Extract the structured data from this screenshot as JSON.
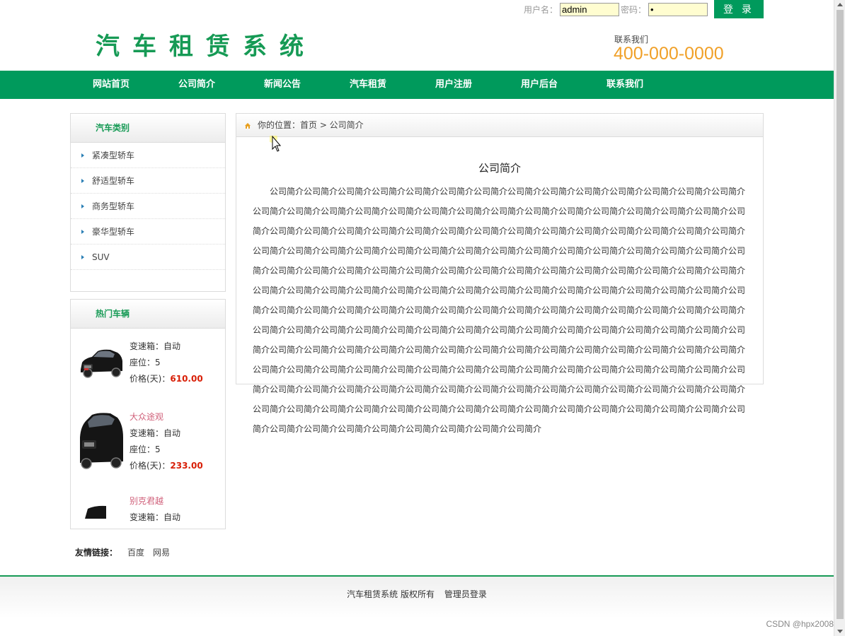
{
  "login": {
    "username_label": "用户名：",
    "username_value": "admin",
    "password_label": "密码：",
    "password_value": "•",
    "button_label": "登 录"
  },
  "header": {
    "logo": "汽车租赁系统",
    "contact_label": "联系我们",
    "contact_phone": "400-000-0000"
  },
  "nav": [
    "网站首页",
    "公司简介",
    "新闻公告",
    "汽车租赁",
    "用户注册",
    "用户后台",
    "联系我们"
  ],
  "sidebar": {
    "category_title": "汽车类别",
    "categories": [
      "紧凑型轿车",
      "舒适型轿车",
      "商务型轿车",
      "豪华型轿车",
      "SUV"
    ],
    "hot_title": "热门车辆",
    "hot_cars": [
      {
        "name": "",
        "gearbox": "变速箱：自动",
        "seats": "座位：5",
        "price_label": "价格(天)：",
        "price": "610.00"
      },
      {
        "name": "大众途观",
        "gearbox": "变速箱：自动",
        "seats": "座位：5",
        "price_label": "价格(天)：",
        "price": "233.00"
      },
      {
        "name": "别克君越",
        "gearbox": "变速箱：自动",
        "seats": "",
        "price_label": "",
        "price": ""
      }
    ]
  },
  "content": {
    "breadcrumb": "你的位置：首页 > 公司简介",
    "title": "公司简介",
    "body": "公司简介公司简介公司简介公司简介公司简介公司简介公司简介公司简介公司简介公司简介公司简介公司简介公司简介公司简介公司简介公司简介公司简介公司简介公司简介公司简介公司简介公司简介公司简介公司简介公司简介公司简介公司简介公司简介公司简介公司简介公司简介公司简介公司简介公司简介公司简介公司简介公司简介公司简介公司简介公司简介公司简介公司简介公司简介公司简介公司简介公司简介公司简介公司简介公司简介公司简介公司简介公司简介公司简介公司简介公司简介公司简介公司简介公司简介公司简介公司简介公司简介公司简介公司简介公司简介公司简介公司简介公司简介公司简介公司简介公司简介公司简介公司简介公司简介公司简介公司简介公司简介公司简介公司简介公司简介公司简介公司简介公司简介公司简介公司简介公司简介公司简介公司简介公司简介公司简介公司简介公司简介公司简介公司简介公司简介公司简介公司简介公司简介公司简介公司简介公司简介公司简介公司简介公司简介公司简介公司简介公司简介公司简介公司简介公司简介公司简介公司简介公司简介公司简介公司简介公司简介公司简介公司简介公司简介公司简介公司简介公司简介公司简介公司简介公司简介公司简介公司简介公司简介公司简介公司简介公司简介公司简介公司简介公司简介公司简介公司简介公司简介公司简介公司简介公司简介公司简介公司简介公司简介公司简介公司简介公司简介公司简介公司简介公司简介公司简介公司简介公司简介公司简介公司简介公司简介公司简介公司简介公司简介公司简介公司简介公司简介公司简介公司简介公司简介公司简介公司简介公司简介公司简介公司简介公司简介公司简介公司简介公司简介公司简介公司简介公司简介公司简介公司简介公司简介公司简介公司简介公司简介公司简介"
  },
  "links": {
    "label": "友情链接：",
    "items": [
      "百度",
      "网易"
    ]
  },
  "footer": {
    "copyright": "汽车租赁系统 版权所有",
    "admin_login": "管理员登录"
  },
  "watermark": "CSDN @hpx2008",
  "colors": {
    "brand_green": "#009a5c",
    "phone_orange": "#f0a028",
    "price_red": "#d81e06",
    "car_name_pink": "#d0607a"
  }
}
